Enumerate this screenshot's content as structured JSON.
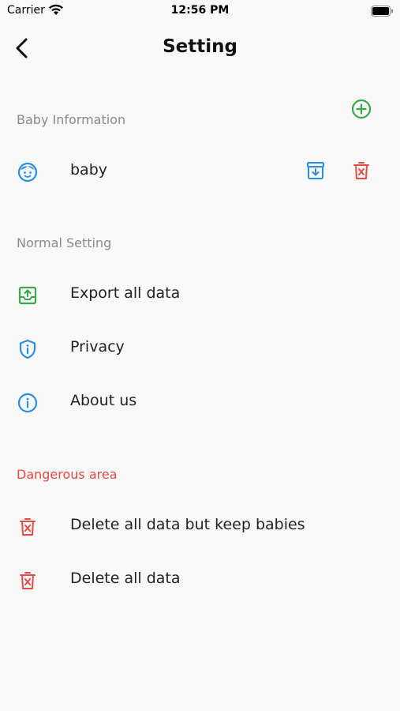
{
  "status_bar": {
    "carrier": "Carrier",
    "time": "12:56 PM"
  },
  "nav": {
    "title": "Setting"
  },
  "baby_section": {
    "header": "Baby Information",
    "babies": [
      {
        "name": "baby"
      }
    ]
  },
  "normal_section": {
    "header": "Normal Setting",
    "items": [
      {
        "label": "Export all data",
        "icon": "export-icon"
      },
      {
        "label": "Privacy",
        "icon": "shield-icon"
      },
      {
        "label": "About us",
        "icon": "info-icon"
      }
    ]
  },
  "danger_section": {
    "header": "Dangerous area",
    "items": [
      {
        "label": "Delete all data but keep babies",
        "icon": "trash-icon"
      },
      {
        "label": "Delete all data",
        "icon": "trash-icon"
      }
    ]
  },
  "colors": {
    "background": "#f8f8f8",
    "accent_blue": "#2a8ee0",
    "accent_green": "#3aa84a",
    "danger_red": "#e34a43",
    "section_gray": "#8a8a8a"
  }
}
